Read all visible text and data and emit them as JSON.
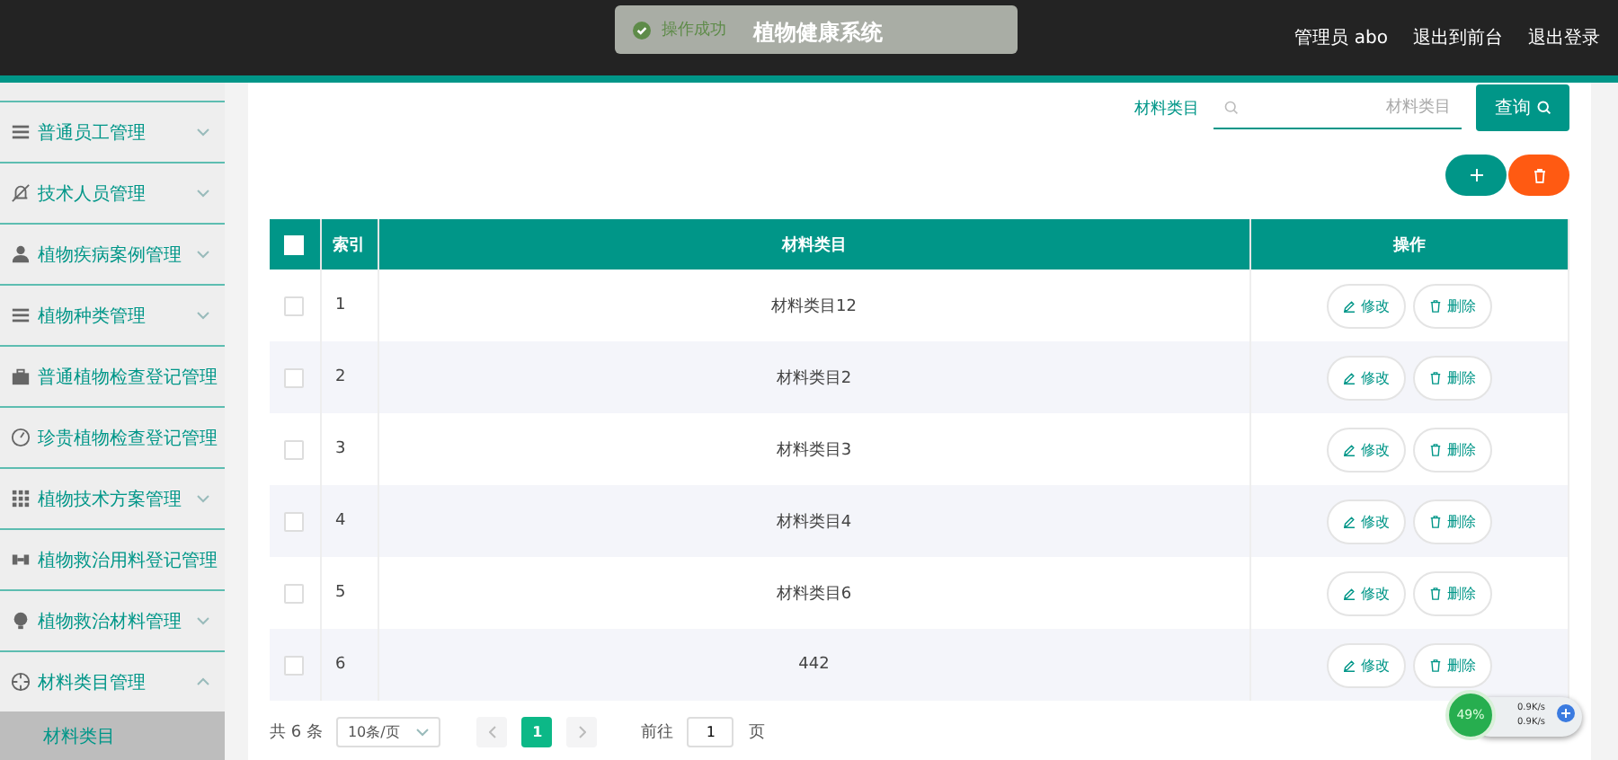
{
  "topbar": {
    "title": "植物健康系统",
    "user": "管理员 abo",
    "links": [
      "退出到前台",
      "退出登录"
    ]
  },
  "toast": {
    "message": "操作成功"
  },
  "sidebar": {
    "items": [
      {
        "label": "普通员工管理",
        "kind": "collapsible",
        "expanded": false
      },
      {
        "label": "技术人员管理",
        "kind": "collapsible",
        "expanded": false
      },
      {
        "label": "植物疾病案例管理",
        "kind": "collapsible",
        "expanded": false
      },
      {
        "label": "植物种类管理",
        "kind": "collapsible",
        "expanded": false
      },
      {
        "label": "普通植物检查登记管理",
        "kind": "plain"
      },
      {
        "label": "珍贵植物检查登记管理",
        "kind": "plain"
      },
      {
        "label": "植物技术方案管理",
        "kind": "collapsible",
        "expanded": false
      },
      {
        "label": "植物救治用料登记管理",
        "kind": "plain"
      },
      {
        "label": "植物救治材料管理",
        "kind": "collapsible",
        "expanded": false
      },
      {
        "label": "材料类目管理",
        "kind": "collapsible",
        "expanded": true,
        "children": [
          {
            "label": "材料类目",
            "selected": true
          }
        ]
      }
    ]
  },
  "search": {
    "label": "材料类目",
    "placeholder": "材料类目",
    "button": "查询"
  },
  "table": {
    "all_checked": false,
    "columns": [
      "索引",
      "材料类目",
      "操作"
    ],
    "rows": [
      {
        "checked": false,
        "index": "1",
        "name": "材料类目12",
        "actions": [
          "修改",
          "删除"
        ]
      },
      {
        "checked": false,
        "index": "2",
        "name": "材料类目2",
        "actions": [
          "修改",
          "删除"
        ]
      },
      {
        "checked": false,
        "index": "3",
        "name": "材料类目3",
        "actions": [
          "修改",
          "删除"
        ]
      },
      {
        "checked": false,
        "index": "4",
        "name": "材料类目4",
        "actions": [
          "修改",
          "删除"
        ]
      },
      {
        "checked": false,
        "index": "5",
        "name": "材料类目6",
        "actions": [
          "修改",
          "删除"
        ]
      },
      {
        "checked": false,
        "index": "6",
        "name": "442",
        "actions": [
          "修改",
          "删除"
        ]
      }
    ]
  },
  "pagination": {
    "total": "共 6 条",
    "page_size": "10条/页",
    "pages": [
      {
        "label": "1",
        "selected": true
      }
    ],
    "goto_label": "前往",
    "goto_value": "1",
    "goto_suffix": "页"
  },
  "net_widget": {
    "percent": "49%",
    "up": "0.9K/s",
    "down": "0.9K/s"
  }
}
